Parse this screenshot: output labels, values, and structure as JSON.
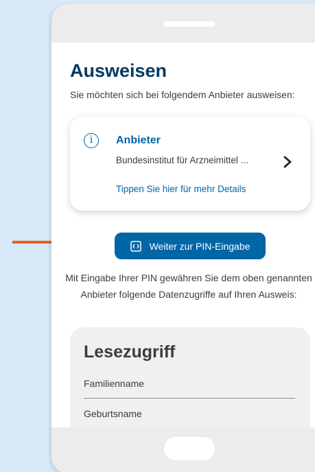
{
  "screen": {
    "title": "Ausweisen",
    "subtitle": "Sie möchten sich bei folgendem Anbieter ausweisen:"
  },
  "provider_card": {
    "icon": "info-icon",
    "label": "Anbieter",
    "name": "Bundesinstitut für Arzneimittel ...",
    "details_link": "Tippen Sie hier für mehr Details",
    "chevron_icon": "chevron-right-icon"
  },
  "pin_button": {
    "label": "Weiter zur PIN-Eingabe",
    "icon": "pin-entry-icon"
  },
  "info_text": "Mit Eingabe Ihrer PIN gewähren Sie dem oben genannten Anbieter folgende Datenzugriffe auf Ihren Ausweis:",
  "read_access": {
    "title": "Lesezugriff",
    "items": [
      "Familienname",
      "Geburtsname"
    ]
  },
  "colors": {
    "accent": "#0066a6",
    "title": "#003a61",
    "arrow": "#e8601c",
    "background": "#d9e8f8"
  }
}
